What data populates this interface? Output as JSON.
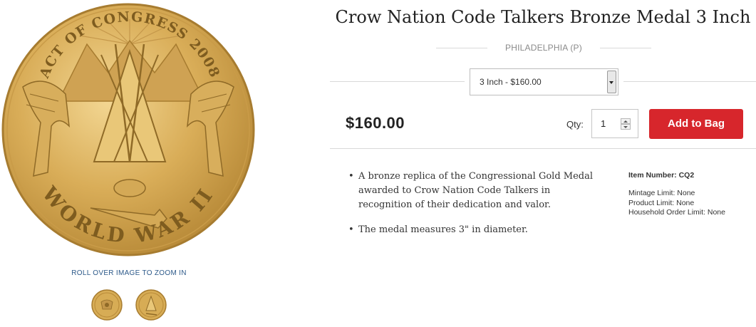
{
  "product": {
    "title": "Crow Nation Code Talkers Bronze Medal 3 Inch",
    "mint": "PHILADELPHIA (P)",
    "option_selected": "3 Inch - $160.00",
    "price": "$160.00",
    "qty_label": "Qty:",
    "qty_value": "1",
    "add_button": "Add to Bag"
  },
  "gallery": {
    "zoom_hint": "ROLL OVER IMAGE TO ZOOM IN",
    "medal_inscription_top": "ACT OF CONGRESS 2008",
    "medal_inscription_bottom": "WORLD WAR II",
    "thumbnails": [
      "medal-obverse-thumb",
      "medal-reverse-thumb"
    ]
  },
  "description": [
    "A bronze replica of the Congressional Gold Medal awarded to Crow Nation Code Talkers in recognition of their dedication and valor.",
    "The medal measures 3\" in diameter."
  ],
  "specs": {
    "item_number": "Item Number: CQ2",
    "mintage_limit": "Mintage Limit: None",
    "product_limit": "Product Limit: None",
    "household_limit": "Household Order Limit: None"
  },
  "colors": {
    "accent": "#d7262c",
    "medal_gold": "#d7ac55",
    "link_blue": "#2d5a8a"
  }
}
